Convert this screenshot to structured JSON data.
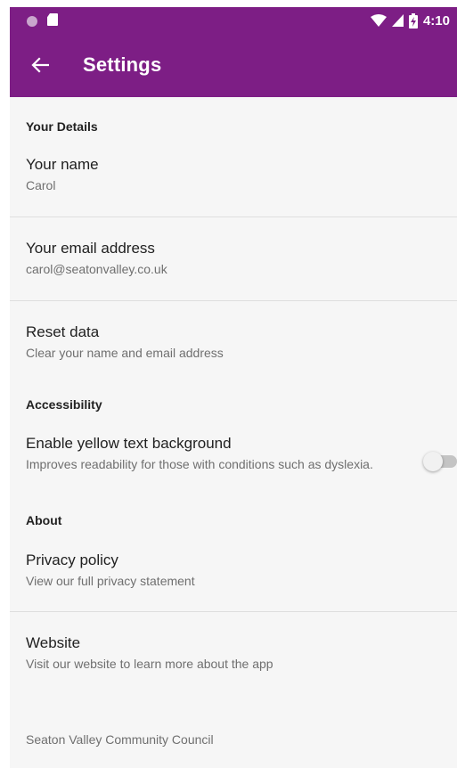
{
  "status_bar": {
    "time": "4:10",
    "icons": [
      "notification-dot-icon",
      "sd-card-icon",
      "wifi-icon",
      "cell-signal-icon",
      "battery-charging-icon"
    ]
  },
  "app_bar": {
    "title": "Settings",
    "back_icon": "arrow-left-icon",
    "color": "#7d1e85"
  },
  "sections": {
    "your_details": {
      "header": "Your Details",
      "name": {
        "title": "Your name",
        "summary": "Carol"
      },
      "email": {
        "title": "Your email address",
        "summary": "carol@seatonvalley.co.uk"
      },
      "reset": {
        "title": "Reset data",
        "summary": "Clear your name and email address"
      }
    },
    "accessibility": {
      "header": "Accessibility",
      "yellow_bg": {
        "title": "Enable yellow text background",
        "summary": "Improves readability for those with conditions such as dyslexia.",
        "enabled": false
      }
    },
    "about": {
      "header": "About",
      "privacy": {
        "title": "Privacy policy",
        "summary": "View our full privacy statement"
      },
      "website": {
        "title": "Website",
        "summary": "Visit our website to learn more about the app"
      },
      "footer": "Seaton Valley Community Council"
    }
  }
}
